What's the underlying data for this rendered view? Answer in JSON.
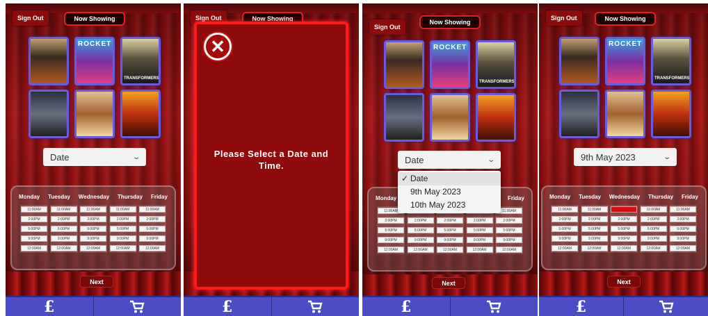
{
  "common": {
    "sign_out": "Sign Out",
    "now_showing": "Now Showing",
    "next": "Next",
    "nav_currency": "£",
    "nav_cart_icon": "cart-icon",
    "days": [
      "Monday",
      "Tuesday",
      "Wednesday",
      "Thursday",
      "Friday"
    ],
    "times": [
      "11:00AM",
      "2:00PM",
      "5:00PM",
      "9:00PM",
      "12:00AM"
    ],
    "posters": [
      {
        "label": "ROCKET",
        "icon": "movie-poster"
      },
      {
        "label": "TRANSFORMERS",
        "icon": "movie-poster"
      },
      {
        "label": "",
        "icon": "movie-poster"
      },
      {
        "label": "",
        "icon": "movie-poster"
      },
      {
        "label": "",
        "icon": "movie-poster"
      },
      {
        "label": "",
        "icon": "movie-poster"
      }
    ]
  },
  "screen1": {
    "date_value": "Date"
  },
  "screen2": {
    "close_symbol": "✕",
    "message": "Please Select a Date and Time."
  },
  "screen3": {
    "date_value": "Date",
    "dropdown": [
      "Date",
      "9th May 2023",
      "10th May 2023"
    ],
    "checked_index": 0,
    "check_mark": "✓"
  },
  "screen4": {
    "date_value": "9th May 2023",
    "selected_slot": {
      "day": "Wednesday",
      "time": "11:00AM"
    }
  },
  "colors": {
    "accent_red": "#e02020",
    "nav_blue": "#4b4dc7",
    "poster_border": "#6a5bd8"
  }
}
